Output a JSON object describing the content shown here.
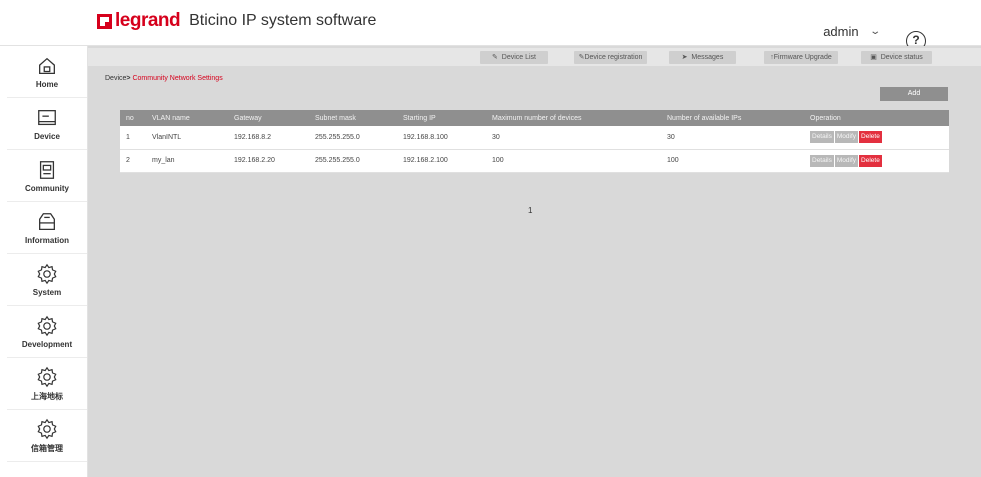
{
  "header": {
    "brand": "legrand",
    "title": "Bticino IP system software",
    "user": "admin",
    "help": "?"
  },
  "sidebar": {
    "items": [
      {
        "label": "Home",
        "icon": "home-icon"
      },
      {
        "label": "Device",
        "icon": "monitor-icon"
      },
      {
        "label": "Community",
        "icon": "panel-icon"
      },
      {
        "label": "Information",
        "icon": "info-box-icon"
      },
      {
        "label": "System",
        "icon": "gear-icon"
      },
      {
        "label": "Development",
        "icon": "gear-icon"
      },
      {
        "label": "上海地标",
        "icon": "gear-icon"
      },
      {
        "label": "信箱管理",
        "icon": "gear-icon"
      }
    ]
  },
  "toolbar": {
    "device_list": "Device List",
    "device_registration": "Device registration",
    "messages": "Messages",
    "firmware_upgrade": "Firmware Upgrade",
    "device_status": "Device status"
  },
  "breadcrumb": {
    "parent": "Device",
    "current": "Community Network Settings"
  },
  "add_label": "Add",
  "table": {
    "headers": [
      "no",
      "VLAN name",
      "Gateway",
      "Subnet mask",
      "Starting IP",
      "Maximum number of devices",
      "Number of available IPs",
      "Operation"
    ],
    "rows": [
      {
        "no": "1",
        "vlan": "VlanINTL",
        "gateway": "192.168.8.2",
        "mask": "255.255.255.0",
        "start": "192.168.8.100",
        "max": "30",
        "avail": "30"
      },
      {
        "no": "2",
        "vlan": "my_lan",
        "gateway": "192.168.2.20",
        "mask": "255.255.255.0",
        "start": "192.168.2.100",
        "max": "100",
        "avail": "100"
      }
    ],
    "ops": {
      "details": "Details",
      "modify": "Modify",
      "delete": "Delete"
    }
  },
  "pager": {
    "page": "1"
  },
  "colors": {
    "brand": "#d6001c",
    "delete": "#e3303f",
    "header_bg": "#8f8f8f",
    "content_bg": "#d9d9d9"
  }
}
